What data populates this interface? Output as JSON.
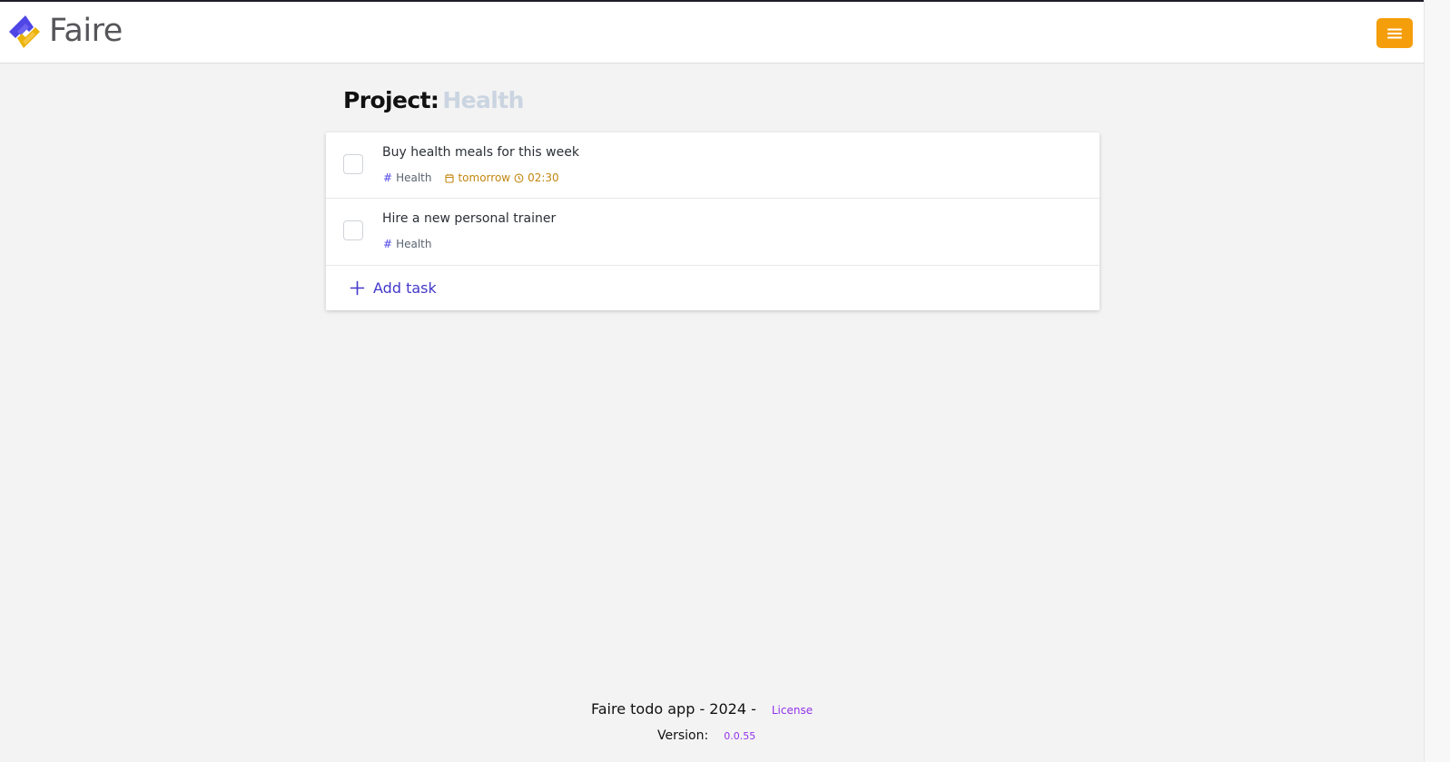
{
  "app": {
    "brand_name": "Faire",
    "brand_colors": {
      "blue": "#4f46e5",
      "yellow": "#eab308"
    },
    "menu_color": "#f59e0b"
  },
  "project": {
    "label": "Project:",
    "name": "Health"
  },
  "tasks": [
    {
      "title": "Buy health meals for this week",
      "tag": "Health",
      "due_date": "tomorrow",
      "due_time": "02:30",
      "completed": false
    },
    {
      "title": "Hire a new personal trainer",
      "tag": "Health",
      "completed": false
    }
  ],
  "add_task": {
    "label": "Add task"
  },
  "icons": {
    "menu": "hamburger-icon",
    "tag": "hash-icon",
    "date": "calendar-icon",
    "time": "clock-icon",
    "add": "plus-icon"
  },
  "footer": {
    "text": "Faire todo app - 2024 -",
    "license_label": "License",
    "version_label": "Version:",
    "version_value": "0.0.55"
  }
}
